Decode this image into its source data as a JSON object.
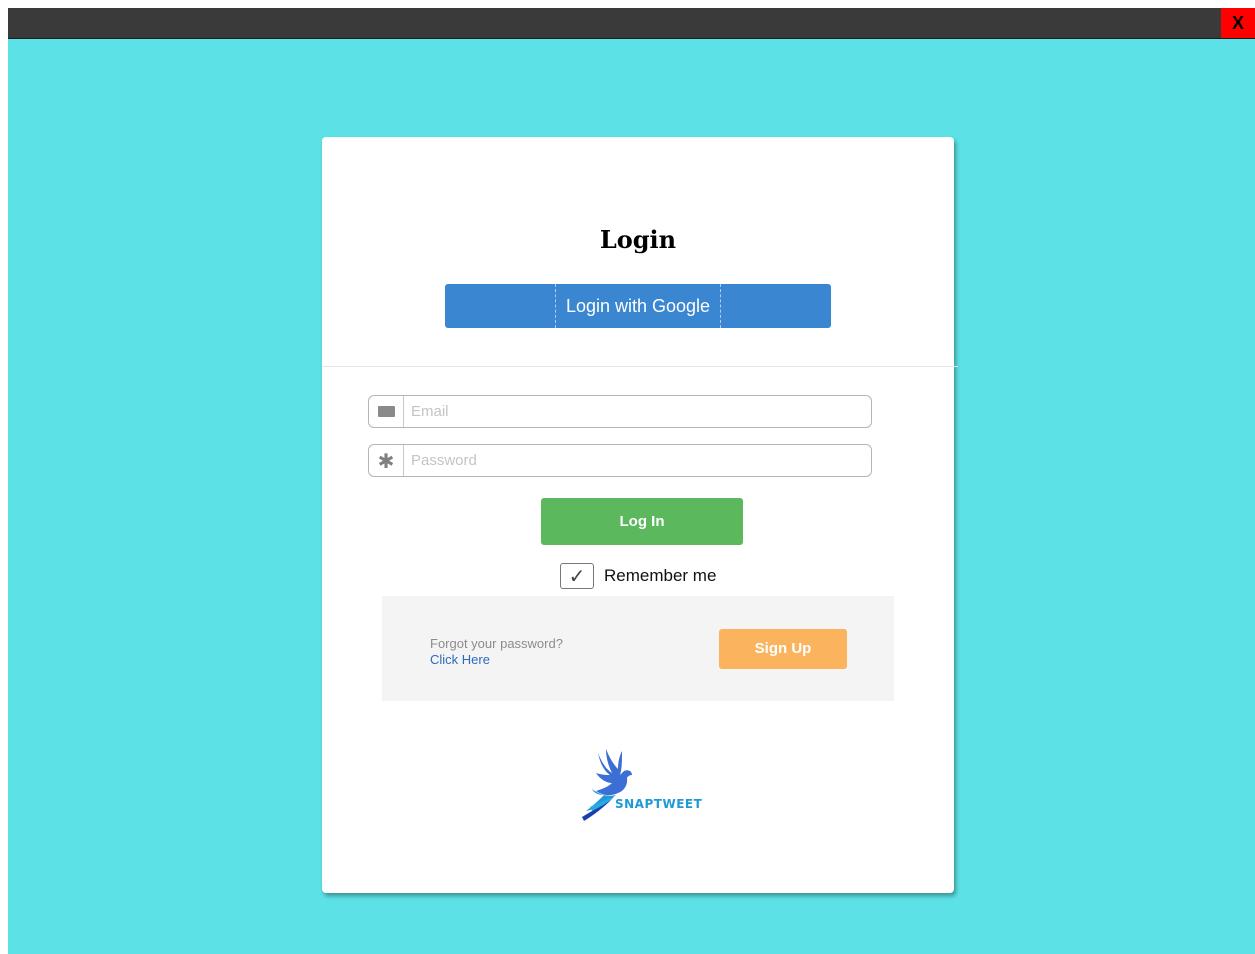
{
  "window": {
    "close_label": "X"
  },
  "login": {
    "title": "Login",
    "google_button": "Login with Google",
    "email_placeholder": "Email",
    "password_placeholder": "Password",
    "login_button": "Log In",
    "remember_label": "Remember me",
    "remember_checked": true
  },
  "footer": {
    "forgot_text": "Forgot your password?",
    "click_here": "Click Here",
    "signup_button": "Sign Up"
  },
  "brand": {
    "name": "SNAPTWEET",
    "logo_icon": "bird-logo-icon"
  },
  "colors": {
    "background": "#5ce2e6",
    "google_blue": "#3b86d1",
    "login_green": "#5cb85c",
    "signup_orange": "#fbb35e",
    "close_red": "#ff0000"
  }
}
